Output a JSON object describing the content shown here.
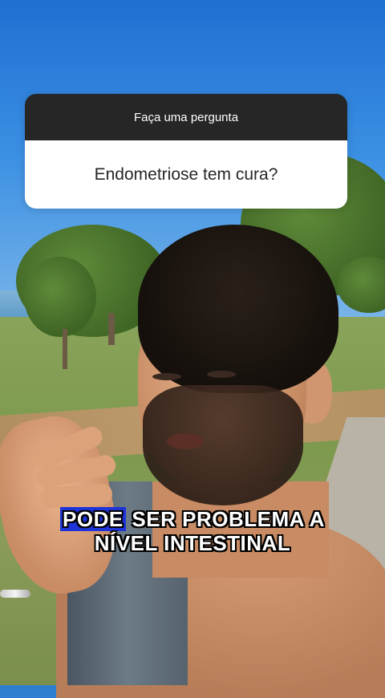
{
  "question_sticker": {
    "header": "Faça uma pergunta",
    "question": "Endometriose tem cura?"
  },
  "caption": {
    "highlight_word": "PODE",
    "line1_rest": " SER PROBLEMA A",
    "line2": "NÍVEL INTESTINAL",
    "highlight_color": "#1f34d8"
  }
}
